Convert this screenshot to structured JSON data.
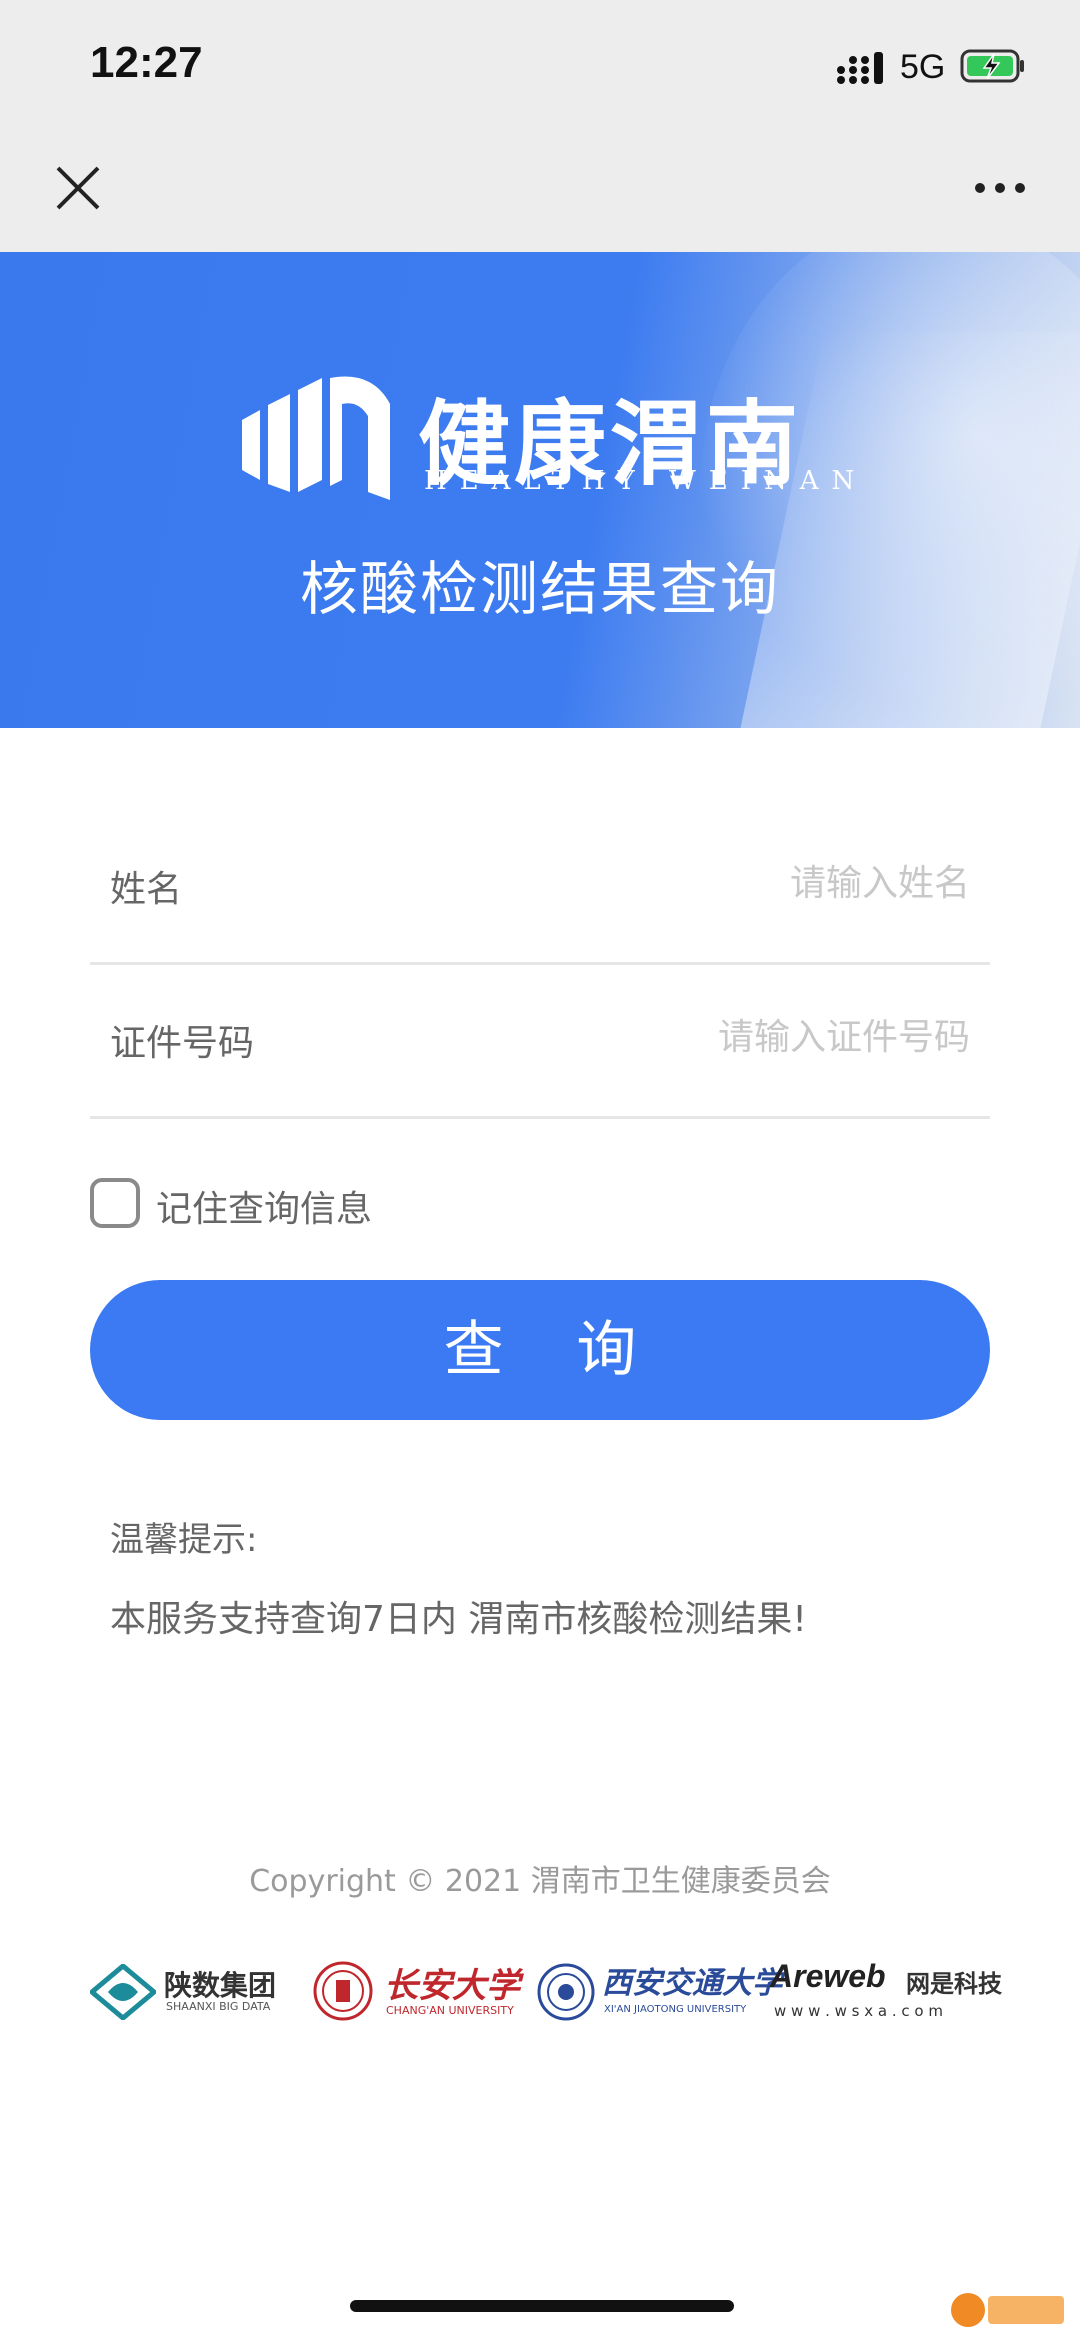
{
  "status_bar": {
    "time": "12:27",
    "network": "5G"
  },
  "nav": {
    "close": "close",
    "more": "more"
  },
  "banner": {
    "brand_cn": "健康渭南",
    "brand_en": "HEALTHY WEINAN",
    "title": "核酸检测结果查询"
  },
  "form": {
    "name": {
      "label": "姓名",
      "placeholder": "请输入姓名",
      "value": ""
    },
    "id_number": {
      "label": "证件号码",
      "placeholder": "请输入证件号码",
      "value": ""
    },
    "remember": {
      "label": "记住查询信息",
      "checked": false
    },
    "submit_label": "查 询"
  },
  "tips": {
    "title": "温馨提示:",
    "text": "本服务支持查询7日内 渭南市核酸检测结果!"
  },
  "footer": {
    "copyright": "Copyright © 2021 渭南市卫生健康委员会",
    "partners": [
      {
        "name_cn": "陕数集团",
        "name_en": "SHAANXI BIG DATA"
      },
      {
        "name_cn": "长安大学",
        "name_en": "CHANG'AN UNIVERSITY"
      },
      {
        "name_cn": "西安交通大学",
        "name_en": "XI'AN JIAOTONG UNIVERSITY"
      },
      {
        "name_cn": "网是科技",
        "brand": "Areweb",
        "site": "w w w . w s x a . c o m"
      }
    ]
  },
  "colors": {
    "primary": "#3b7af2",
    "banner": "#3a78ee",
    "statusbar": "#ededed"
  },
  "icons": [
    "close-icon",
    "more-icon",
    "signal-icon",
    "battery-charging-icon",
    "checkbox-icon"
  ]
}
